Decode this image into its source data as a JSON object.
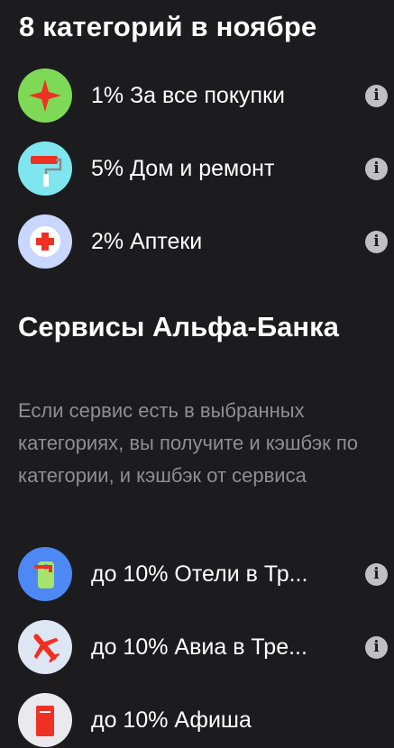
{
  "header": {
    "title": "8 категорий в ноябре"
  },
  "categories": [
    {
      "label": "1% За все покупки",
      "icon": "sparkle-star-icon",
      "bg": "#7ed957"
    },
    {
      "label": "5% Дом и ремонт",
      "icon": "paint-roller-icon",
      "bg": "#7fe6f0"
    },
    {
      "label": "2% Аптеки",
      "icon": "pharmacy-cross-icon",
      "bg": "#c9d7ff"
    }
  ],
  "services": {
    "title": "Сервисы Альфа-Банка",
    "description": "Если сервис есть в выбранных категориях, вы получите и кэшбэк по категории, и кэшбэк от сервиса",
    "items": [
      {
        "label": "до 10% Отели в Тр...",
        "icon": "hotel-door-hanger-icon",
        "bg": "#4d88f5"
      },
      {
        "label": "до 10% Авиа в Тре...",
        "icon": "airplane-icon",
        "bg": "#dde6f3"
      },
      {
        "label": "до 10% Афиша",
        "icon": "ticket-icon",
        "bg": "#e9e9ee"
      }
    ]
  },
  "info_symbol": "i"
}
